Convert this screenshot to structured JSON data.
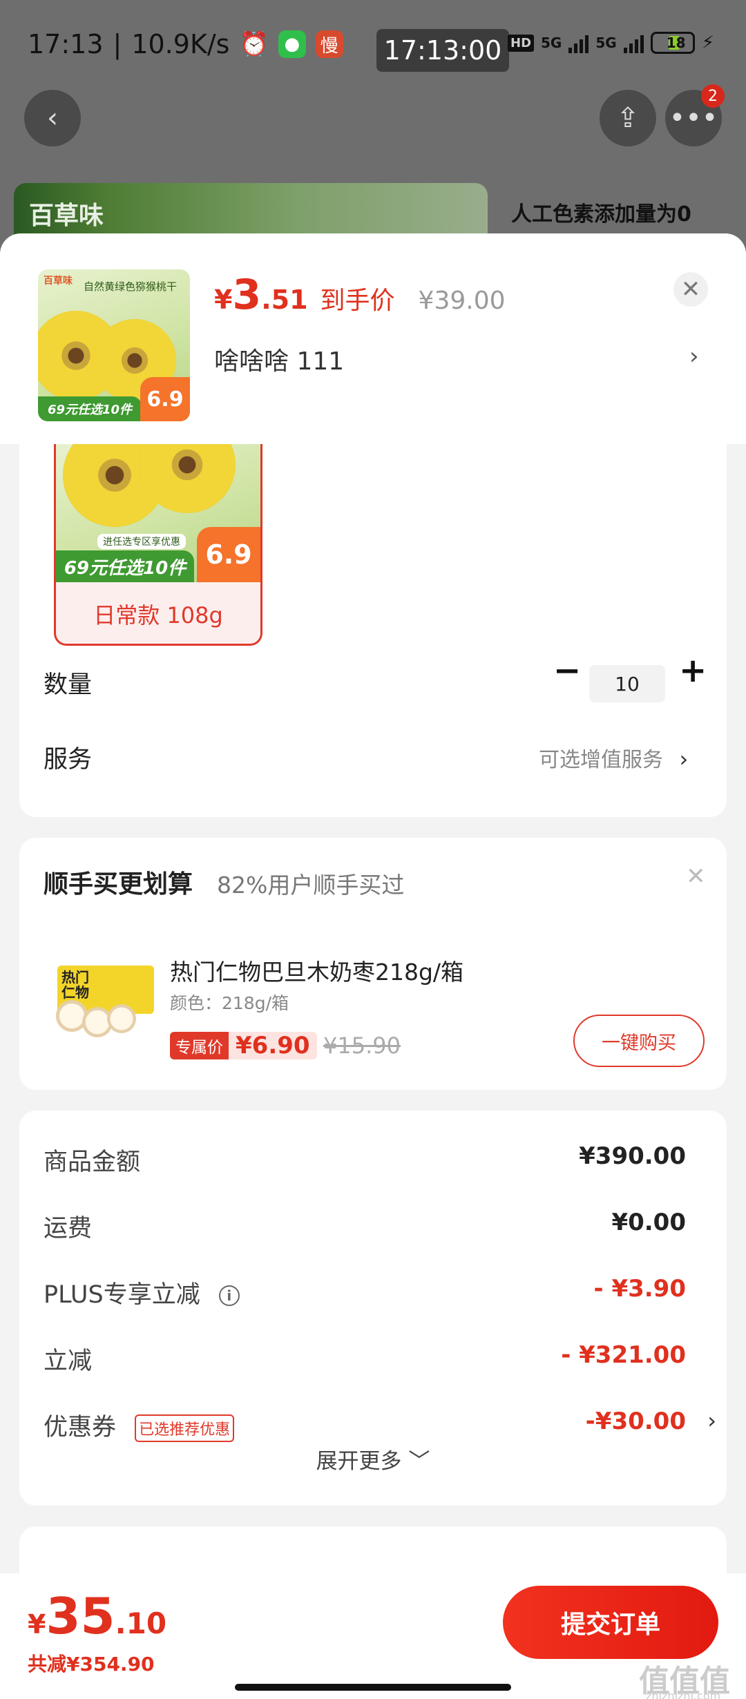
{
  "status_bar": {
    "time": "17:13",
    "speed": "10.9K/s",
    "clock": "17:13:00",
    "network_a": "5G",
    "network_b": "5G",
    "hd": "HD",
    "battery": "18"
  },
  "background": {
    "brand_logo": "百草味",
    "banner_text": "人工色素添加量为0",
    "more_badge": "2"
  },
  "sheet_header": {
    "currency": "¥",
    "price_int": "3",
    "price_dec": ".51",
    "price_label": "到手价",
    "original_price": "¥39.00",
    "selected_spec": "啥啥啥  111",
    "thumb_logo": "百草味",
    "thumb_title": "自然黄绿色猕猴桃干",
    "thumb_ribbon": "69元任选10件",
    "thumb_price": "6.9"
  },
  "spec": {
    "variant_label": "日常款 108g",
    "variant_promo": "进任选专区享优惠",
    "variant_ribbon": "69元任选10件",
    "variant_price": "6.9",
    "quantity_label": "数量",
    "quantity_value": "10",
    "minus": "−",
    "plus": "+",
    "service_label": "服务",
    "service_value": "可选增值服务"
  },
  "bundle": {
    "title": "顺手买更划算",
    "subtitle": "82%用户顺手买过",
    "product_name": "热门仁物巴旦木奶枣218g/箱",
    "variant": "颜色：218g/箱",
    "tag": "专属价",
    "price": "¥6.90",
    "original_price": "¥15.90",
    "buy_label": "一键购买",
    "box_text": "热门\n仁物"
  },
  "price_detail": {
    "rows": [
      {
        "label": "商品金额",
        "value": "¥390.00"
      },
      {
        "label": "运费",
        "value": "¥0.00"
      },
      {
        "label": "PLUS专享立减",
        "value": "- ¥3.90"
      },
      {
        "label": "立减",
        "value": "- ¥321.00"
      },
      {
        "label": "优惠券",
        "value": "-¥30.00",
        "tag": "已选推荐优惠"
      }
    ],
    "expand_label": "展开更多 ﹀"
  },
  "bottom": {
    "currency": "¥",
    "total_int": "35",
    "total_dec": ".10",
    "saved": "共减¥354.90",
    "submit_label": "提交订单",
    "watermark": "值值值",
    "watermark_sub": "zhizhizhi.com"
  },
  "colors": {
    "accent_red": "#e0301e",
    "overlay_gray": "#6e6e6e"
  }
}
